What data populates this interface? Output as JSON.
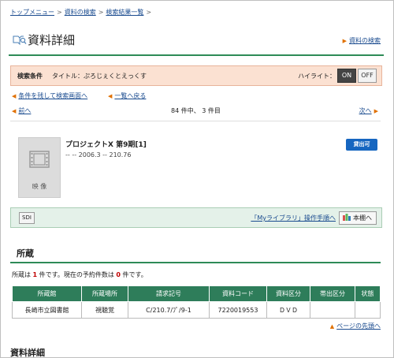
{
  "breadcrumb": {
    "items": [
      "トップメニュー",
      "資料の検索",
      "検索結果一覧"
    ],
    "sep": ">",
    "trailing": ">"
  },
  "header": {
    "title": "資料詳細",
    "search_link": "資料の検索"
  },
  "search_conditions": {
    "label": "検索条件",
    "value": "タイトル：ぷろじぇくとえっくす",
    "highlight_label": "ハイライト：",
    "on": "ON",
    "off": "OFF"
  },
  "nav": {
    "keep_conditions": "条件を残して検索画面へ",
    "back_to_list": "一覧へ戻る",
    "prev": "前へ",
    "next": "次へ",
    "position": "84 件中、 3 件目"
  },
  "item": {
    "media_label": "映 像",
    "title": "プロジェクトX 第9期[1]",
    "subtitle": "-- -- 2006.3 -- 210.76",
    "status": "貸出可"
  },
  "sdi_bar": {
    "sdi_button": "SDI",
    "my_library_link": "「Myライブラリ」操作手順へ",
    "bookshelf_button": "本棚へ",
    "colors": {
      "bar1": "#d9534f",
      "bar2": "#5cb85c",
      "bar3": "#337ab7"
    }
  },
  "holdings": {
    "title": "所蔵",
    "summary_prefix": "所蔵は",
    "count_holdings": "1",
    "summary_mid": "件です。現在の予約件数は",
    "count_reservations": "0",
    "summary_suffix": "件です。",
    "columns": [
      "所蔵館",
      "所蔵場所",
      "請求記号",
      "資料コード",
      "資料区分",
      "帯出区分",
      "状態"
    ],
    "rows": [
      [
        "長崎市立図書館",
        "視聴覚",
        "C/210.7/ﾌﾟ/9-1",
        "7220019553",
        "ＤＶＤ",
        "",
        ""
      ]
    ]
  },
  "page_top_link": "ページの先頭へ",
  "details_title": "資料詳細",
  "colors": {
    "accent_green": "#2e8b57",
    "condition_bg": "#fbe1d2",
    "status_blue": "#1666c0"
  }
}
